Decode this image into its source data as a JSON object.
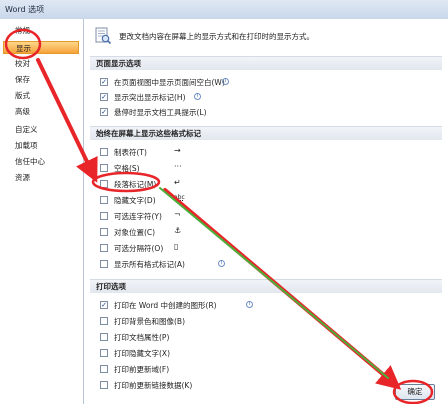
{
  "window": {
    "title": "Word 选项"
  },
  "sidebar": {
    "items": [
      {
        "label": "常规"
      },
      {
        "label": "显示"
      },
      {
        "label": "校对"
      },
      {
        "label": "保存"
      },
      {
        "label": "版式"
      },
      {
        "label": "高级"
      },
      {
        "label": "自定义"
      },
      {
        "label": "加载项"
      },
      {
        "label": "信任中心"
      },
      {
        "label": "资源"
      }
    ],
    "active_index": 1
  },
  "main": {
    "header_text": "更改文档内容在屏幕上的显示方式和在打印时的显示方式。",
    "sections": [
      {
        "title": "页面显示选项",
        "options": [
          {
            "label": "在页面视图中显示页面间空白(W)",
            "checked": true
          },
          {
            "label": "显示突出显示标记(H)",
            "checked": true
          },
          {
            "label": "悬停时显示文档工具提示(L)",
            "checked": true
          }
        ]
      },
      {
        "title": "始终在屏幕上显示这些格式标记",
        "options": [
          {
            "label": "制表符(T)",
            "checked": false,
            "symbol": "→"
          },
          {
            "label": "空格(S)",
            "checked": false,
            "symbol": "···"
          },
          {
            "label": "段落标记(M)",
            "checked": false,
            "symbol": "↵"
          },
          {
            "label": "隐藏文字(D)",
            "checked": false,
            "symbol": "abc"
          },
          {
            "label": "可选连字符(Y)",
            "checked": false,
            "symbol": "¬"
          },
          {
            "label": "对象位置(C)",
            "checked": false,
            "symbol": "⚓"
          },
          {
            "label": "可选分隔符(O)",
            "checked": false,
            "symbol": "▯"
          },
          {
            "label": "显示所有格式标记(A)",
            "checked": false,
            "symbol": ""
          }
        ]
      },
      {
        "title": "打印选项",
        "options": [
          {
            "label": "打印在 Word 中创建的图形(R)",
            "checked": true
          },
          {
            "label": "打印背景色和图像(B)",
            "checked": false
          },
          {
            "label": "打印文档属性(P)",
            "checked": false
          },
          {
            "label": "打印隐藏文字(X)",
            "checked": false
          },
          {
            "label": "打印前更新域(F)",
            "checked": false
          },
          {
            "label": "打印前更新链接数据(K)",
            "checked": false
          }
        ]
      }
    ]
  },
  "footer": {
    "ok_label": "确定"
  },
  "icons": {
    "info": "info-icon",
    "header": "document-magnifier-icon"
  },
  "colors": {
    "annotation": "#e8262a",
    "arrow_secondary": "#4caf3a",
    "active_nav": "#f5a23a"
  }
}
